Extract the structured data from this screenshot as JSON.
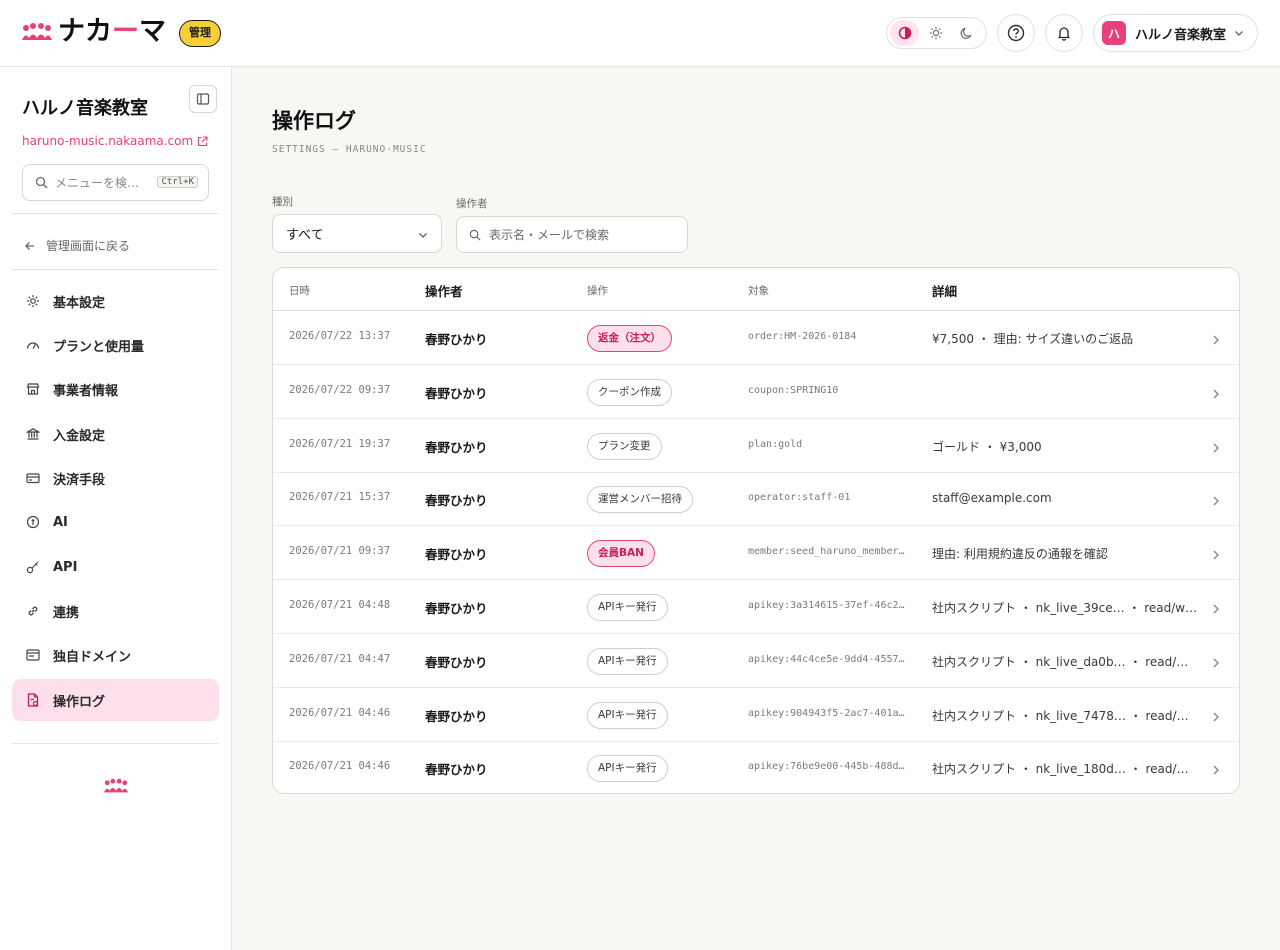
{
  "header": {
    "logo_text_a": "ナカ",
    "logo_text_dash": "ー",
    "logo_text_b": "マ",
    "badge": "管理",
    "org_avatar": "ハ",
    "org_name": "ハルノ音楽教室"
  },
  "sidebar": {
    "title": "ハルノ音楽教室",
    "site_link": "haruno-music.nakaama.com",
    "search_placeholder": "メニューを検…",
    "search_shortcut": "Ctrl+K",
    "back_label": "管理画面に戻る",
    "items": [
      {
        "label": "基本設定",
        "icon": "sun-gear-icon"
      },
      {
        "label": "プランと使用量",
        "icon": "gauge-icon"
      },
      {
        "label": "事業者情報",
        "icon": "store-icon"
      },
      {
        "label": "入金設定",
        "icon": "bank-icon"
      },
      {
        "label": "決済手段",
        "icon": "credit-card-icon"
      },
      {
        "label": "AI",
        "icon": "ai-icon"
      },
      {
        "label": "API",
        "icon": "key-icon"
      },
      {
        "label": "連携",
        "icon": "link-icon"
      },
      {
        "label": "独自ドメイン",
        "icon": "browser-icon"
      },
      {
        "label": "操作ログ",
        "icon": "log-file-icon"
      }
    ],
    "active_index": 9
  },
  "page": {
    "title": "操作ログ",
    "subtitle": "SETTINGS — HARUNO-MUSIC"
  },
  "filters": {
    "type_label": "種別",
    "type_value": "すべて",
    "operator_label": "操作者",
    "operator_placeholder": "表示名・メールで検索"
  },
  "table": {
    "headers": {
      "time": "日時",
      "operator": "操作者",
      "action": "操作",
      "target": "対象",
      "detail": "詳細"
    },
    "rows": [
      {
        "time": "2026/07/22 13:37",
        "operator": "春野ひかり",
        "action": "返金（注文）",
        "danger": true,
        "target": "order:HM-2026-0184",
        "detail": "¥7,500 ・ 理由: サイズ違いのご返品"
      },
      {
        "time": "2026/07/22 09:37",
        "operator": "春野ひかり",
        "action": "クーポン作成",
        "danger": false,
        "target": "coupon:SPRING10",
        "detail": ""
      },
      {
        "time": "2026/07/21 19:37",
        "operator": "春野ひかり",
        "action": "プラン変更",
        "danger": false,
        "target": "plan:gold",
        "detail": "ゴールド ・ ¥3,000"
      },
      {
        "time": "2026/07/21 15:37",
        "operator": "春野ひかり",
        "action": "運営メンバー招待",
        "danger": false,
        "target": "operator:staff-01",
        "detail": "staff@example.com"
      },
      {
        "time": "2026/07/21 09:37",
        "operator": "春野ひかり",
        "action": "会員BAN",
        "danger": true,
        "target": "member:seed_haruno_member…",
        "detail": "理由: 利用規約違反の通報を確認"
      },
      {
        "time": "2026/07/21 04:48",
        "operator": "春野ひかり",
        "action": "APIキー発行",
        "danger": false,
        "target": "apikey:3a314615-37ef-46c2…",
        "detail": "社内スクリプト ・ nk_live_39ce… ・ read/w…"
      },
      {
        "time": "2026/07/21 04:47",
        "operator": "春野ひかり",
        "action": "APIキー発行",
        "danger": false,
        "target": "apikey:44c4ce5e-9dd4-4557…",
        "detail": "社内スクリプト ・ nk_live_da0b… ・ read/w…"
      },
      {
        "time": "2026/07/21 04:46",
        "operator": "春野ひかり",
        "action": "APIキー発行",
        "danger": false,
        "target": "apikey:904943f5-2ac7-401a…",
        "detail": "社内スクリプト ・ nk_live_7478… ・ read/wr…"
      },
      {
        "time": "2026/07/21 04:46",
        "operator": "春野ひかり",
        "action": "APIキー発行",
        "danger": false,
        "target": "apikey:76be9e00-445b-488d…",
        "detail": "社内スクリプト ・ nk_live_180d… ・ read/w…"
      }
    ]
  },
  "colors": {
    "accent": "#e8407c",
    "badge": "#f5cf36",
    "active_bg": "#fde0eb"
  }
}
